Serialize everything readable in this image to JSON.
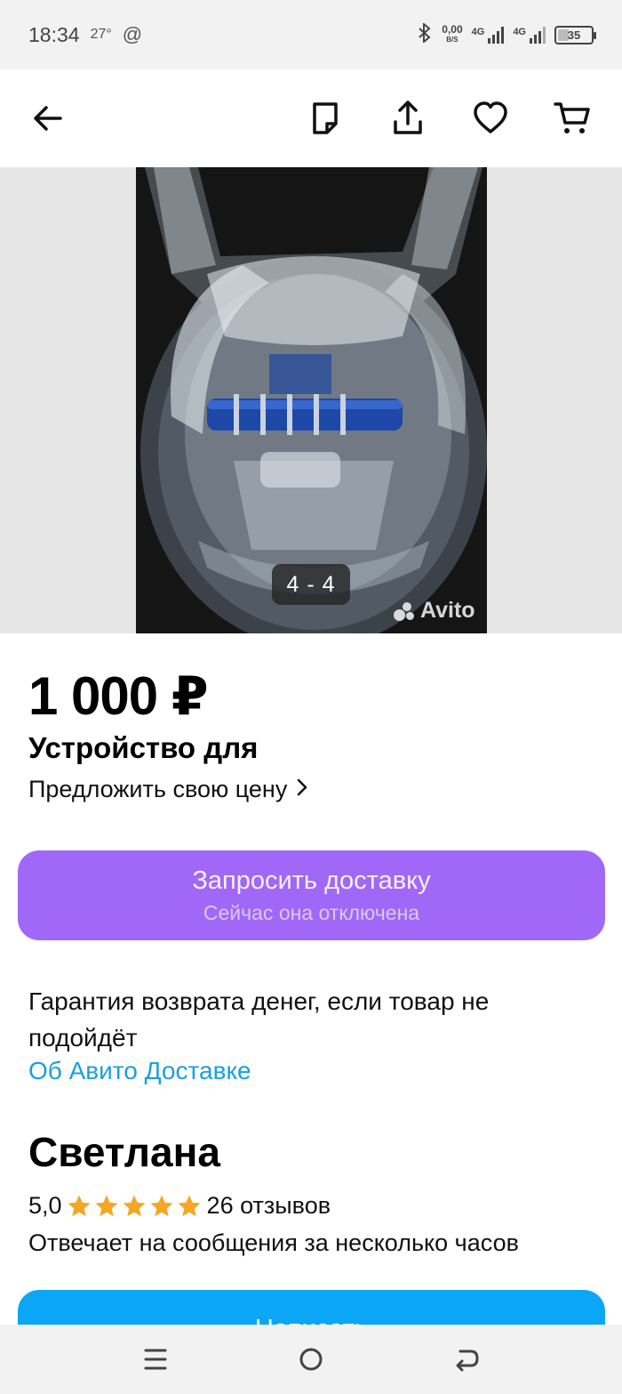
{
  "status_bar": {
    "time": "18:34",
    "temperature": "27°",
    "at_symbol": "@",
    "net_speed": "0,00",
    "net_unit": "B/S",
    "signal_1_label": "4G",
    "signal_2_label": "4G",
    "battery": "35"
  },
  "header": {
    "icons": [
      "back-arrow-icon",
      "note-icon",
      "share-icon",
      "heart-icon",
      "cart-icon"
    ]
  },
  "gallery": {
    "counter": "4 - 4",
    "watermark": "Avito"
  },
  "listing": {
    "price": "1 000 ₽",
    "title": "Устройство для",
    "offer_price_label": "Предложить свою цену",
    "offer_chevron": "›"
  },
  "delivery_button": {
    "label": "Запросить доставку",
    "sublabel": "Сейчас она отключена",
    "color": "#a168f7"
  },
  "guarantee": {
    "text": "Гарантия возврата денег, если товар не подойдёт",
    "link": "Об Авито Доставке",
    "link_color": "#1a9fe0"
  },
  "seller": {
    "name": "Светлана",
    "rating": "5,0",
    "stars": 5,
    "star_color": "#f5a623",
    "reviews": "26 отзывов",
    "response_time": "Отвечает на сообщения за несколько часов"
  },
  "write_button": {
    "label": "Написать",
    "color": "#0ba6f5"
  },
  "nav_bar": {
    "icons": [
      "menu-icon",
      "home-circle-icon",
      "back-icon"
    ]
  }
}
